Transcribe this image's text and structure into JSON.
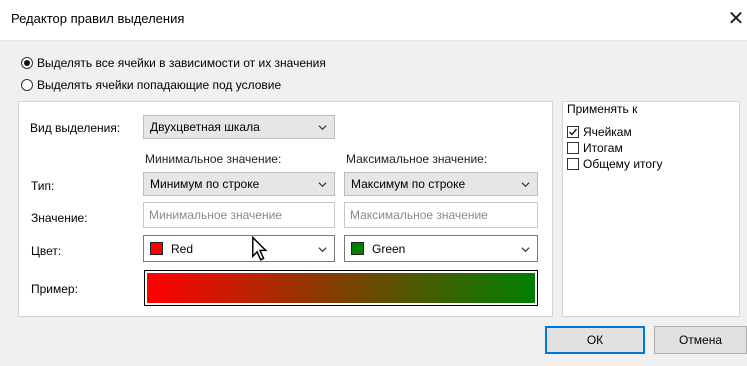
{
  "window": {
    "title": "Редактор правил выделения",
    "close_glyph": "✕"
  },
  "mode": {
    "option_all": "Выделять все ячейки в зависимости от их значения",
    "option_condition": "Выделять ячейки попадающие под условие",
    "selected": "option_all"
  },
  "rule": {
    "highlight_type_label": "Вид выделения:",
    "highlight_type_value": "Двухцветная шкала",
    "min_header": "Минимальное значение:",
    "max_header": "Максимальное значение:",
    "type_label": "Тип:",
    "min_type": "Минимум по строке",
    "max_type": "Максимум по строке",
    "value_label": "Значение:",
    "min_value_placeholder": "Минимальное значение",
    "max_value_placeholder": "Максимальное значение",
    "color_label": "Цвет:",
    "min_color_name": "Red",
    "max_color_name": "Green",
    "min_color_hex": "#ff0000",
    "max_color_hex": "#008000",
    "preview_label": "Пример:"
  },
  "apply_to": {
    "header": "Применять к",
    "items": [
      {
        "label": "Ячейкам",
        "checked": true
      },
      {
        "label": "Итогам",
        "checked": false
      },
      {
        "label": "Общему итогу",
        "checked": false
      }
    ]
  },
  "buttons": {
    "ok": "ОК",
    "cancel": "Отмена"
  }
}
